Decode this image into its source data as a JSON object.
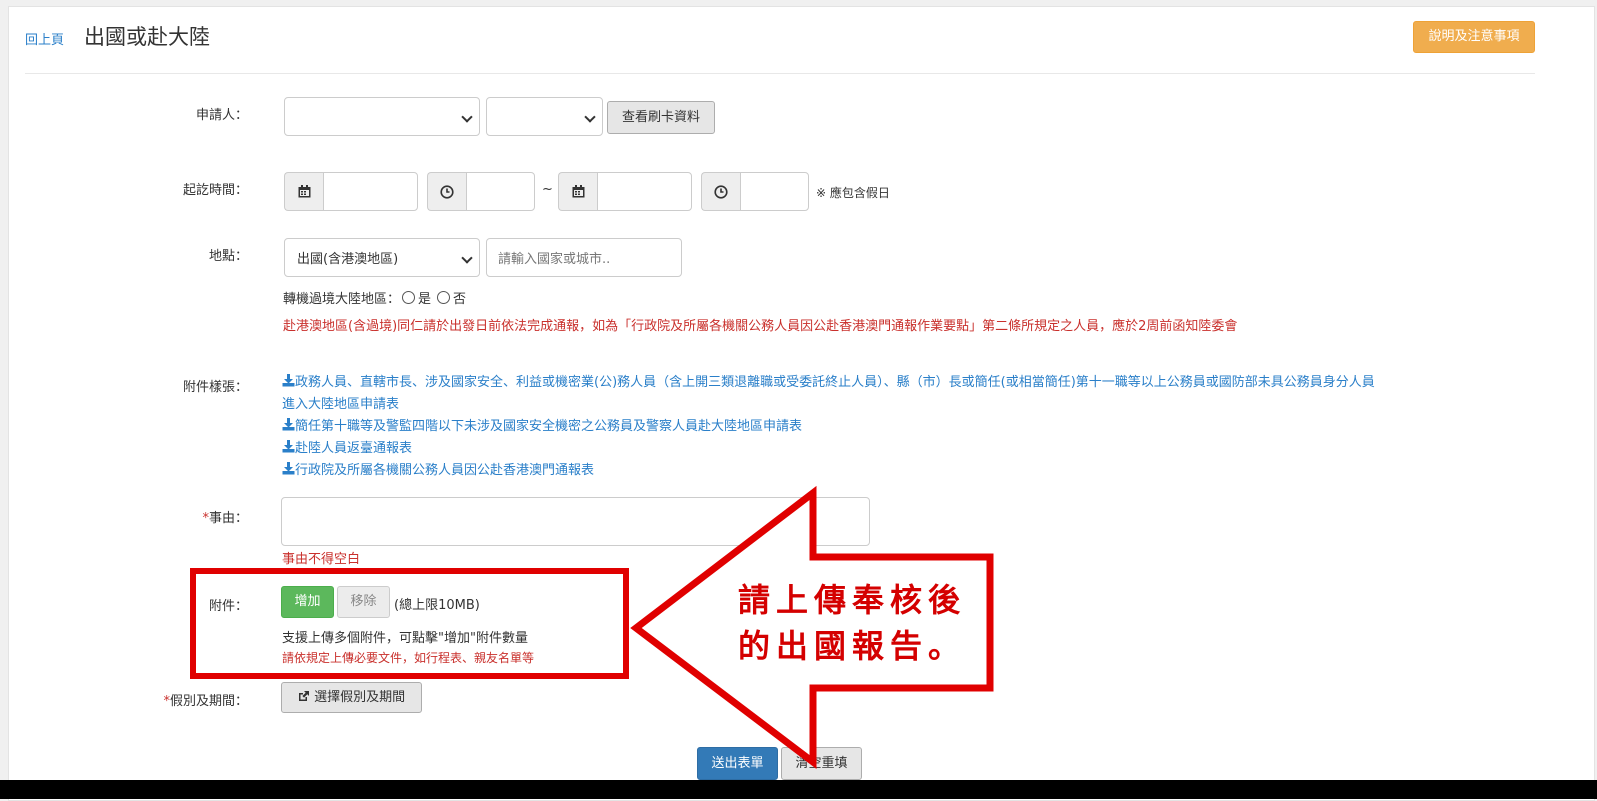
{
  "header": {
    "back_label": "回上頁",
    "title": "出國或赴大陸",
    "notice_button": "說明及注意事項"
  },
  "applicant": {
    "label": "申請人：",
    "select1_value": "",
    "select2_value": "",
    "card_button": "查看刷卡資料"
  },
  "period": {
    "label": "起訖時間：",
    "separator": "~",
    "start_date": "",
    "start_time": "",
    "end_date": "",
    "end_time": "",
    "note": "※ 應包含假日"
  },
  "location": {
    "label": "地點：",
    "select_value": "出國(含港澳地區)",
    "input_placeholder": "請輸入國家或城市..",
    "transit_label": "轉機過境大陸地區：",
    "option_yes": "是",
    "option_no": "否",
    "warning": "赴港澳地區(含過境)同仁請於出發日前依法完成通報，如為「行政院及所屬各機關公務人員因公赴香港澳門通報作業要點」第二條所規定之人員，應於2周前函知陸委會"
  },
  "templates": {
    "label": "附件樣張：",
    "items": [
      "政務人員、直轄市長、涉及國家安全、利益或機密業(公)務人員（含上開三類退離職或受委託終止人員）、縣（市）長或簡任(或相當簡任)第十一職等以上公務員或國防部未具公務員身分人員",
      "進入大陸地區申請表",
      "簡任第十職等及警監四階以下未涉及國家安全機密之公務員及警察人員赴大陸地區申請表",
      "赴陸人員返臺通報表",
      "行政院及所屬各機關公務人員因公赴香港澳門通報表"
    ]
  },
  "reason": {
    "required_mark": "*",
    "label": "事由：",
    "value": "",
    "error": "事由不得空白"
  },
  "attachment": {
    "label": "附件：",
    "add_button": "增加",
    "remove_button": "移除",
    "limit": "(總上限10MB)",
    "hint": "支援上傳多個附件，可點擊\"增加\"附件數量",
    "note": "請依規定上傳必要文件，如行程表、親友名單等"
  },
  "leave": {
    "required_mark": "*",
    "label": "假別及期間：",
    "button": "選擇假別及期間"
  },
  "actions": {
    "submit": "送出表單",
    "reset": "清空重填"
  },
  "callout": {
    "line1": "請上傳奉核後",
    "line2": "的出國報告。"
  },
  "colors": {
    "link": "#2a7fc9",
    "warning_red": "#c9302c",
    "annotation_red": "#e00000",
    "notice_orange": "#f0ad4e",
    "add_green": "#5cb85c",
    "submit_blue": "#337ab7"
  },
  "icons": {
    "calendar": "calendar-icon",
    "clock": "clock-icon",
    "download": "download-icon",
    "external": "external-link-icon",
    "arrow": "arrow-left-annotation"
  }
}
